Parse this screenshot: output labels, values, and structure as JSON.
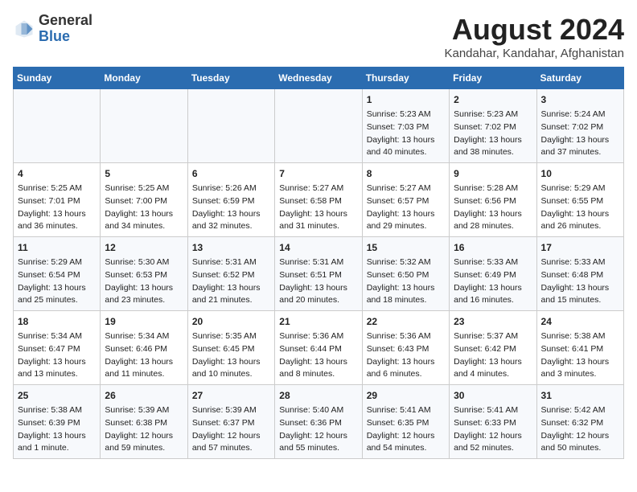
{
  "header": {
    "logo_line1": "General",
    "logo_line2": "Blue",
    "title": "August 2024",
    "subtitle": "Kandahar, Kandahar, Afghanistan"
  },
  "weekdays": [
    "Sunday",
    "Monday",
    "Tuesday",
    "Wednesday",
    "Thursday",
    "Friday",
    "Saturday"
  ],
  "weeks": [
    [
      {
        "day": "",
        "content": ""
      },
      {
        "day": "",
        "content": ""
      },
      {
        "day": "",
        "content": ""
      },
      {
        "day": "",
        "content": ""
      },
      {
        "day": "1",
        "content": "Sunrise: 5:23 AM\nSunset: 7:03 PM\nDaylight: 13 hours\nand 40 minutes."
      },
      {
        "day": "2",
        "content": "Sunrise: 5:23 AM\nSunset: 7:02 PM\nDaylight: 13 hours\nand 38 minutes."
      },
      {
        "day": "3",
        "content": "Sunrise: 5:24 AM\nSunset: 7:02 PM\nDaylight: 13 hours\nand 37 minutes."
      }
    ],
    [
      {
        "day": "4",
        "content": "Sunrise: 5:25 AM\nSunset: 7:01 PM\nDaylight: 13 hours\nand 36 minutes."
      },
      {
        "day": "5",
        "content": "Sunrise: 5:25 AM\nSunset: 7:00 PM\nDaylight: 13 hours\nand 34 minutes."
      },
      {
        "day": "6",
        "content": "Sunrise: 5:26 AM\nSunset: 6:59 PM\nDaylight: 13 hours\nand 32 minutes."
      },
      {
        "day": "7",
        "content": "Sunrise: 5:27 AM\nSunset: 6:58 PM\nDaylight: 13 hours\nand 31 minutes."
      },
      {
        "day": "8",
        "content": "Sunrise: 5:27 AM\nSunset: 6:57 PM\nDaylight: 13 hours\nand 29 minutes."
      },
      {
        "day": "9",
        "content": "Sunrise: 5:28 AM\nSunset: 6:56 PM\nDaylight: 13 hours\nand 28 minutes."
      },
      {
        "day": "10",
        "content": "Sunrise: 5:29 AM\nSunset: 6:55 PM\nDaylight: 13 hours\nand 26 minutes."
      }
    ],
    [
      {
        "day": "11",
        "content": "Sunrise: 5:29 AM\nSunset: 6:54 PM\nDaylight: 13 hours\nand 25 minutes."
      },
      {
        "day": "12",
        "content": "Sunrise: 5:30 AM\nSunset: 6:53 PM\nDaylight: 13 hours\nand 23 minutes."
      },
      {
        "day": "13",
        "content": "Sunrise: 5:31 AM\nSunset: 6:52 PM\nDaylight: 13 hours\nand 21 minutes."
      },
      {
        "day": "14",
        "content": "Sunrise: 5:31 AM\nSunset: 6:51 PM\nDaylight: 13 hours\nand 20 minutes."
      },
      {
        "day": "15",
        "content": "Sunrise: 5:32 AM\nSunset: 6:50 PM\nDaylight: 13 hours\nand 18 minutes."
      },
      {
        "day": "16",
        "content": "Sunrise: 5:33 AM\nSunset: 6:49 PM\nDaylight: 13 hours\nand 16 minutes."
      },
      {
        "day": "17",
        "content": "Sunrise: 5:33 AM\nSunset: 6:48 PM\nDaylight: 13 hours\nand 15 minutes."
      }
    ],
    [
      {
        "day": "18",
        "content": "Sunrise: 5:34 AM\nSunset: 6:47 PM\nDaylight: 13 hours\nand 13 minutes."
      },
      {
        "day": "19",
        "content": "Sunrise: 5:34 AM\nSunset: 6:46 PM\nDaylight: 13 hours\nand 11 minutes."
      },
      {
        "day": "20",
        "content": "Sunrise: 5:35 AM\nSunset: 6:45 PM\nDaylight: 13 hours\nand 10 minutes."
      },
      {
        "day": "21",
        "content": "Sunrise: 5:36 AM\nSunset: 6:44 PM\nDaylight: 13 hours\nand 8 minutes."
      },
      {
        "day": "22",
        "content": "Sunrise: 5:36 AM\nSunset: 6:43 PM\nDaylight: 13 hours\nand 6 minutes."
      },
      {
        "day": "23",
        "content": "Sunrise: 5:37 AM\nSunset: 6:42 PM\nDaylight: 13 hours\nand 4 minutes."
      },
      {
        "day": "24",
        "content": "Sunrise: 5:38 AM\nSunset: 6:41 PM\nDaylight: 13 hours\nand 3 minutes."
      }
    ],
    [
      {
        "day": "25",
        "content": "Sunrise: 5:38 AM\nSunset: 6:39 PM\nDaylight: 13 hours\nand 1 minute."
      },
      {
        "day": "26",
        "content": "Sunrise: 5:39 AM\nSunset: 6:38 PM\nDaylight: 12 hours\nand 59 minutes."
      },
      {
        "day": "27",
        "content": "Sunrise: 5:39 AM\nSunset: 6:37 PM\nDaylight: 12 hours\nand 57 minutes."
      },
      {
        "day": "28",
        "content": "Sunrise: 5:40 AM\nSunset: 6:36 PM\nDaylight: 12 hours\nand 55 minutes."
      },
      {
        "day": "29",
        "content": "Sunrise: 5:41 AM\nSunset: 6:35 PM\nDaylight: 12 hours\nand 54 minutes."
      },
      {
        "day": "30",
        "content": "Sunrise: 5:41 AM\nSunset: 6:33 PM\nDaylight: 12 hours\nand 52 minutes."
      },
      {
        "day": "31",
        "content": "Sunrise: 5:42 AM\nSunset: 6:32 PM\nDaylight: 12 hours\nand 50 minutes."
      }
    ]
  ]
}
